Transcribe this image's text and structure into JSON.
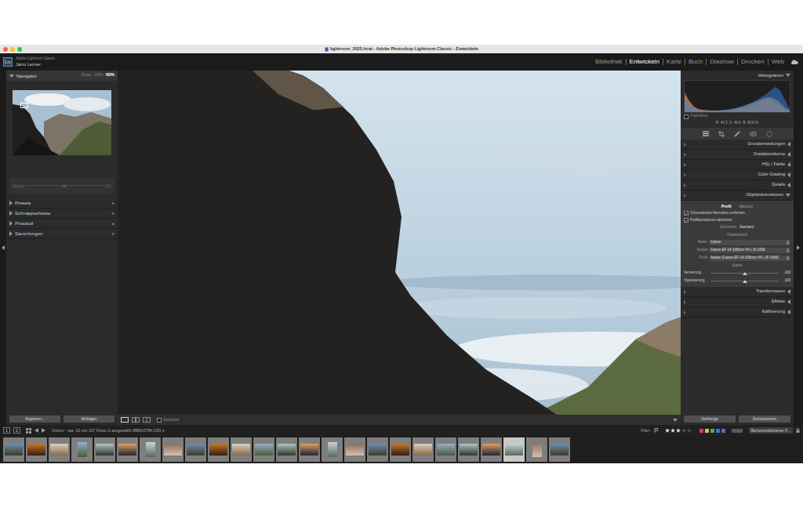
{
  "window": {
    "title": "lightroom_2023.lrcat - Adobe Photoshop Lightroom Classic - Entwickeln",
    "controls": [
      {
        "color": "#ff5f57"
      },
      {
        "color": "#febc2e"
      },
      {
        "color": "#28c840"
      }
    ]
  },
  "identity": {
    "logo": "Lrc",
    "app": "Adobe Lightroom Classic",
    "user": "Janu Lerner"
  },
  "modules": [
    {
      "label": "Bibliothek",
      "selected": false
    },
    {
      "label": "Entwickeln",
      "selected": true
    },
    {
      "label": "Karte",
      "selected": false
    },
    {
      "label": "Buch",
      "selected": false
    },
    {
      "label": "Diashow",
      "selected": false
    },
    {
      "label": "Drucken",
      "selected": false
    },
    {
      "label": "Web",
      "selected": false
    }
  ],
  "left_panel": {
    "navigator": {
      "title": "Navigator",
      "expanded": true,
      "zoom": [
        {
          "label": "Einpa.",
          "selected": false
        },
        {
          "label": "100%",
          "selected": false
        },
        {
          "label": "400%",
          "selected": true
        }
      ]
    },
    "preset_amount": {
      "label": "Menge",
      "reading": "100",
      "level": 0.5,
      "disabled": true
    },
    "sections": [
      {
        "label": "Presets",
        "expanded": false,
        "action": "+"
      },
      {
        "label": "Schnappschüsse",
        "expanded": false,
        "action": "+"
      },
      {
        "label": "Protokoll",
        "expanded": false,
        "action": "×"
      },
      {
        "label": "Sammlungen",
        "expanded": false,
        "action": "+"
      }
    ],
    "buttons": [
      "Kopieren...",
      "Einfügen"
    ]
  },
  "toolbar": {
    "softproof": {
      "label": "Softproof",
      "checked": false
    }
  },
  "right_panel": {
    "histogram": {
      "title": "Histogramm",
      "expanded": true,
      "series": [
        {
          "color": "#e04a3a",
          "values": [
            70,
            40,
            20,
            10,
            8,
            6,
            5,
            5,
            5,
            6,
            8,
            10,
            12,
            14,
            18,
            22,
            30,
            40,
            45,
            38,
            30,
            20,
            10,
            5
          ]
        },
        {
          "color": "#d8c23a",
          "values": [
            60,
            35,
            18,
            10,
            7,
            6,
            5,
            5,
            6,
            7,
            9,
            12,
            16,
            20,
            26,
            32,
            38,
            44,
            48,
            50,
            42,
            30,
            15,
            6
          ]
        },
        {
          "color": "#3a78e0",
          "values": [
            50,
            30,
            15,
            8,
            6,
            5,
            5,
            5,
            6,
            8,
            10,
            13,
            17,
            22,
            28,
            35,
            42,
            52,
            62,
            75,
            85,
            70,
            40,
            10
          ]
        }
      ],
      "original": {
        "label": "Originalfoto",
        "checked": false
      },
      "readout": "R  44,3  G  40,6  B  63,6 %"
    },
    "sections": [
      {
        "label": "Grundeinstellungen",
        "expanded": false
      },
      {
        "label": "Gradationskurve",
        "expanded": false
      },
      {
        "label": "HSL / Farbe",
        "expanded": false
      },
      {
        "label": "Color-Grading",
        "expanded": false
      },
      {
        "label": "Details",
        "expanded": false
      },
      {
        "label": "Objektivkorrekturen",
        "expanded": true
      },
      {
        "label": "Transformieren",
        "expanded": false
      },
      {
        "label": "Effekte",
        "expanded": false
      },
      {
        "label": "Kalibrierung",
        "expanded": false
      }
    ],
    "lens": {
      "tabs": [
        {
          "label": "Profil",
          "selected": true
        },
        {
          "label": "Manuell",
          "selected": false
        }
      ],
      "checks": [
        {
          "label": "Chromatische Aberration entfernen",
          "checked": true
        },
        {
          "label": "Profilkorrekturen aktivieren",
          "checked": true
        }
      ],
      "setup": {
        "label": "Einrichten:",
        "value": "Standard"
      },
      "profile_title": "Objektivprofil",
      "fields": [
        {
          "label": "Marke",
          "value": "Canon"
        },
        {
          "label": "Modell",
          "value": "Canon EF 24-105mm f/4 L IS USM"
        },
        {
          "label": "Profil",
          "value": "Adobe (Canon EF 24-105mm f/4 L IS USM)"
        }
      ],
      "amount_title": "Stärke",
      "sliders": [
        {
          "label": "Verzerrung",
          "reading": "100",
          "level": 0.5
        },
        {
          "label": "Vignettierung",
          "reading": "100",
          "level": 0.5
        }
      ]
    },
    "buttons": [
      "Vorherige",
      "Zurücksetzen"
    ]
  },
  "filmstrip": {
    "monitors": [
      "1",
      "2"
    ],
    "source": "Ordner : raw  23 von 107 Fotos /1 ausgewählt /BB6A3784.CR2 ▾",
    "filter_label": "Filter:",
    "stars": 3,
    "flags": [
      {
        "color": "#d84040"
      },
      {
        "color": "#e0c040"
      },
      {
        "color": "#50b050"
      },
      {
        "color": "#4070d0"
      },
      {
        "color": "#9050c0"
      }
    ],
    "filter_preset": "Benutzerdefinierter F...",
    "thumbnails": [
      {
        "kind": "landscape",
        "selected": false
      },
      {
        "kind": "landscape",
        "selected": false
      },
      {
        "kind": "landscape",
        "selected": false
      },
      {
        "kind": "portrait",
        "selected": false
      },
      {
        "kind": "landscape",
        "selected": false
      },
      {
        "kind": "landscape",
        "selected": false
      },
      {
        "kind": "portrait",
        "selected": false
      },
      {
        "kind": "landscape",
        "selected": false
      },
      {
        "kind": "landscape",
        "selected": false
      },
      {
        "kind": "landscape",
        "selected": false
      },
      {
        "kind": "landscape",
        "selected": false
      },
      {
        "kind": "landscape",
        "selected": false
      },
      {
        "kind": "landscape",
        "selected": false
      },
      {
        "kind": "landscape",
        "selected": false
      },
      {
        "kind": "portrait",
        "selected": false
      },
      {
        "kind": "landscape",
        "selected": false
      },
      {
        "kind": "landscape",
        "selected": false
      },
      {
        "kind": "landscape",
        "selected": false
      },
      {
        "kind": "landscape",
        "selected": false
      },
      {
        "kind": "landscape",
        "selected": false
      },
      {
        "kind": "landscape",
        "selected": false
      },
      {
        "kind": "landscape",
        "selected": false
      },
      {
        "kind": "landscape",
        "selected": true
      },
      {
        "kind": "portrait",
        "selected": false
      },
      {
        "kind": "landscape",
        "selected": false
      }
    ]
  }
}
